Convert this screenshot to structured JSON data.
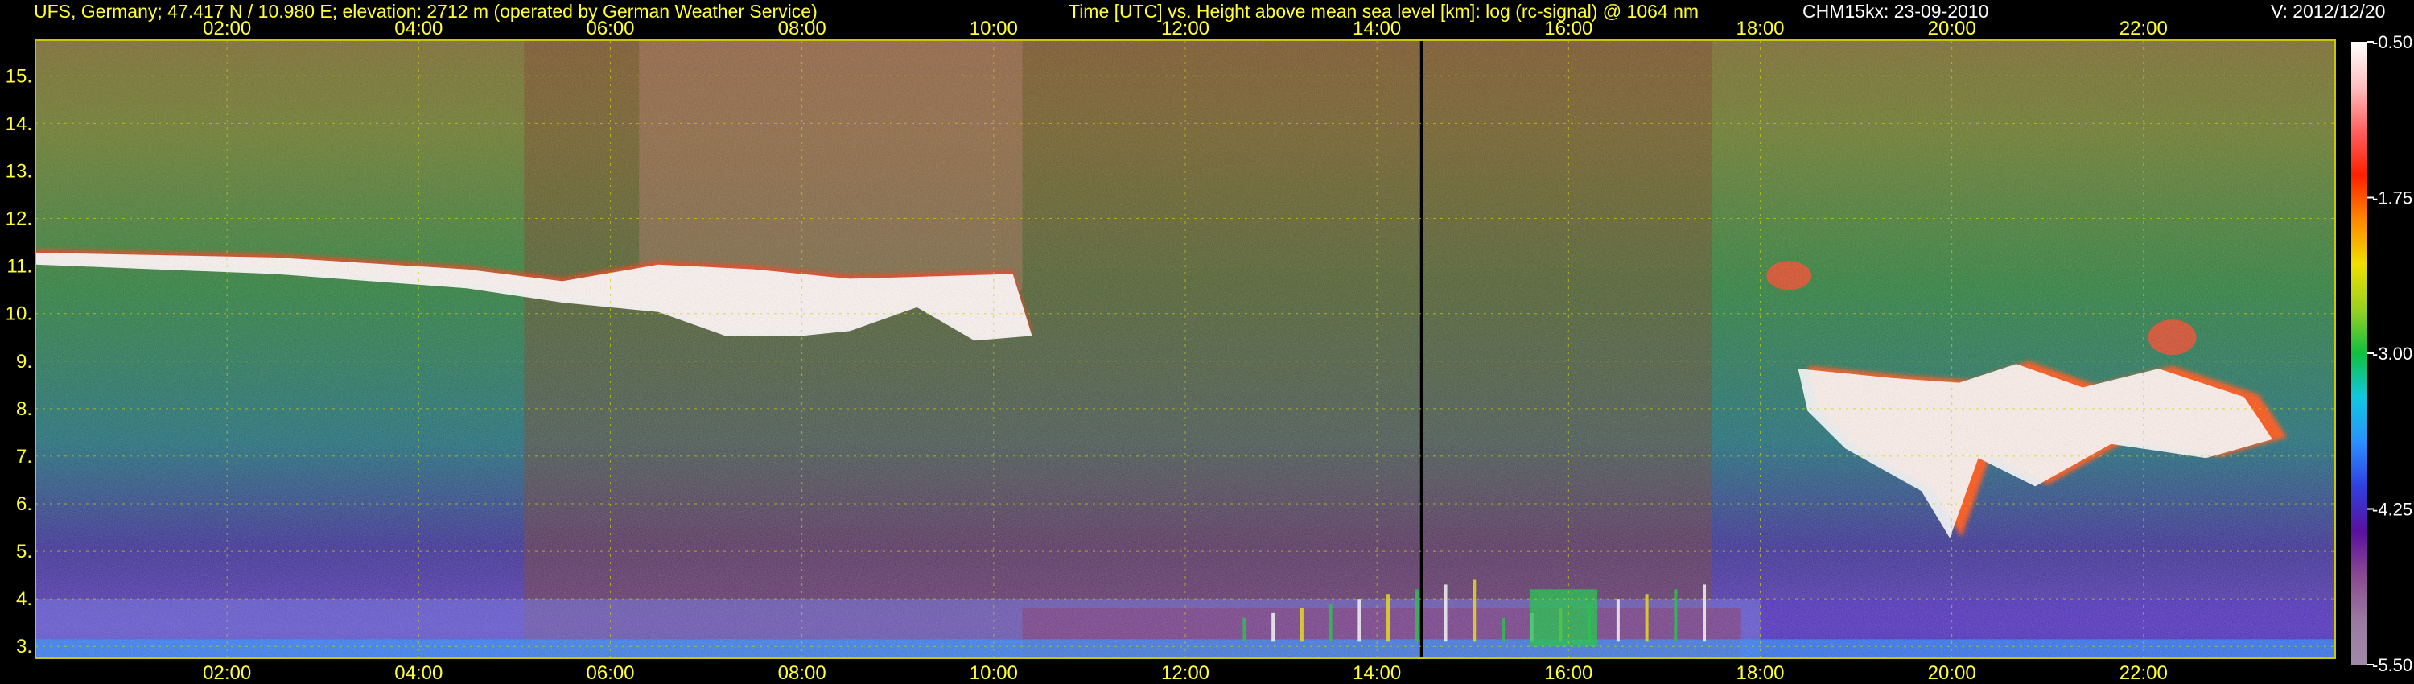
{
  "header": {
    "station": "UFS, Germany; 47.417 N / 10.980 E; elevation: 2712 m  (operated by German Weather Service)",
    "axes_title": "Time [UTC] vs. Height above mean sea level [km]: log (rc-signal) @ 1064 nm",
    "instrument": "CHM15kx: 23-09-2010",
    "version": "V: 2012/12/20"
  },
  "chart_data": {
    "type": "heatmap",
    "title": "Time [UTC] vs. Height above mean sea level [km]: log (rc-signal) @ 1064 nm",
    "x": {
      "ticks": [
        "02:00",
        "04:00",
        "06:00",
        "08:00",
        "10:00",
        "12:00",
        "14:00",
        "16:00",
        "18:00",
        "20:00",
        "22:00"
      ],
      "tick_hours": [
        2,
        4,
        6,
        8,
        10,
        12,
        14,
        16,
        18,
        20,
        22
      ],
      "range_hours": [
        0,
        24
      ]
    },
    "y": {
      "ticks": [
        "3.",
        "4.",
        "5.",
        "6.",
        "7.",
        "8.",
        "9.",
        "10.",
        "11.",
        "12.",
        "13.",
        "14.",
        "15."
      ],
      "tick_values": [
        3,
        4,
        5,
        6,
        7,
        8,
        9,
        10,
        11,
        12,
        13,
        14,
        15
      ],
      "range_km": [
        2.75,
        15.75
      ]
    },
    "colorbar": {
      "ticks": [
        "-0.50",
        "-1.75",
        "-3.00",
        "-4.25",
        "-5.50"
      ],
      "tick_values": [
        -0.5,
        -1.75,
        -3.0,
        -4.25,
        -5.5
      ],
      "range": [
        -5.5,
        -0.5
      ],
      "colors": [
        "#a08aa8",
        "#9a7aa0",
        "#8a4a90",
        "#5a10a0",
        "#3040e0",
        "#2a90ff",
        "#10c8e0",
        "#10c040",
        "#9ad020",
        "#f0e000",
        "#ff8800",
        "#ff2000",
        "#ff6060",
        "#ffc0c0",
        "#ffffff"
      ]
    },
    "features": [
      {
        "name": "cirrus layer",
        "time_hours": [
          0.0,
          10.5
        ],
        "height_km": [
          9.3,
          11.3
        ]
      },
      {
        "name": "cloud layer",
        "time_hours": [
          18.0,
          23.5
        ],
        "height_km": [
          5.0,
          9.2
        ]
      },
      {
        "name": "boundary layer aerosol",
        "time_hours": [
          12.5,
          17.5
        ],
        "height_km": [
          3.0,
          4.2
        ]
      }
    ],
    "grid": true
  }
}
